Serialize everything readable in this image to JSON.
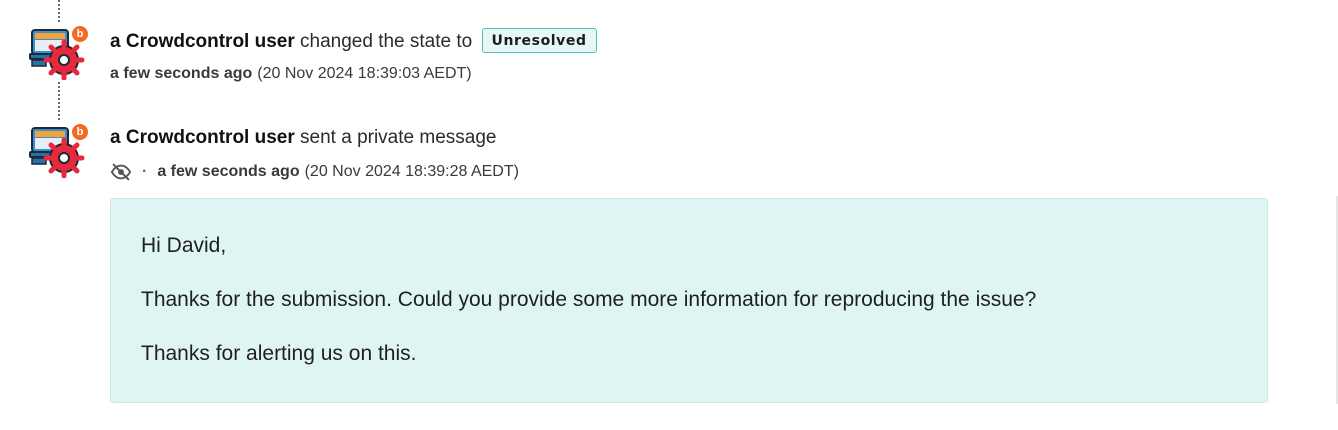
{
  "events": [
    {
      "actor": "a Crowdcontrol user",
      "action": "changed the state to",
      "state_badge": "Unresolved",
      "time_relative": "a few seconds ago",
      "time_absolute": "(20 Nov 2024 18:39:03 AEDT)",
      "avatar_badge": "b"
    },
    {
      "actor": "a Crowdcontrol user",
      "action": "sent a private message",
      "visibility_icon": "eye-off-icon",
      "separator": "·",
      "time_relative": "a few seconds ago",
      "time_absolute": "(20 Nov 2024 18:39:28 AEDT)",
      "avatar_badge": "b",
      "message": [
        "Hi David,",
        "Thanks for the submission. Could you provide some more information for reproducing the issue?",
        "Thanks for alerting us on this."
      ]
    }
  ],
  "colors": {
    "badge_border": "#4cc4b1",
    "badge_bg": "#e6f8f5",
    "message_bg": "#def5f3",
    "avatar_notification": "#f26b21",
    "gear_red": "#e8283c"
  }
}
